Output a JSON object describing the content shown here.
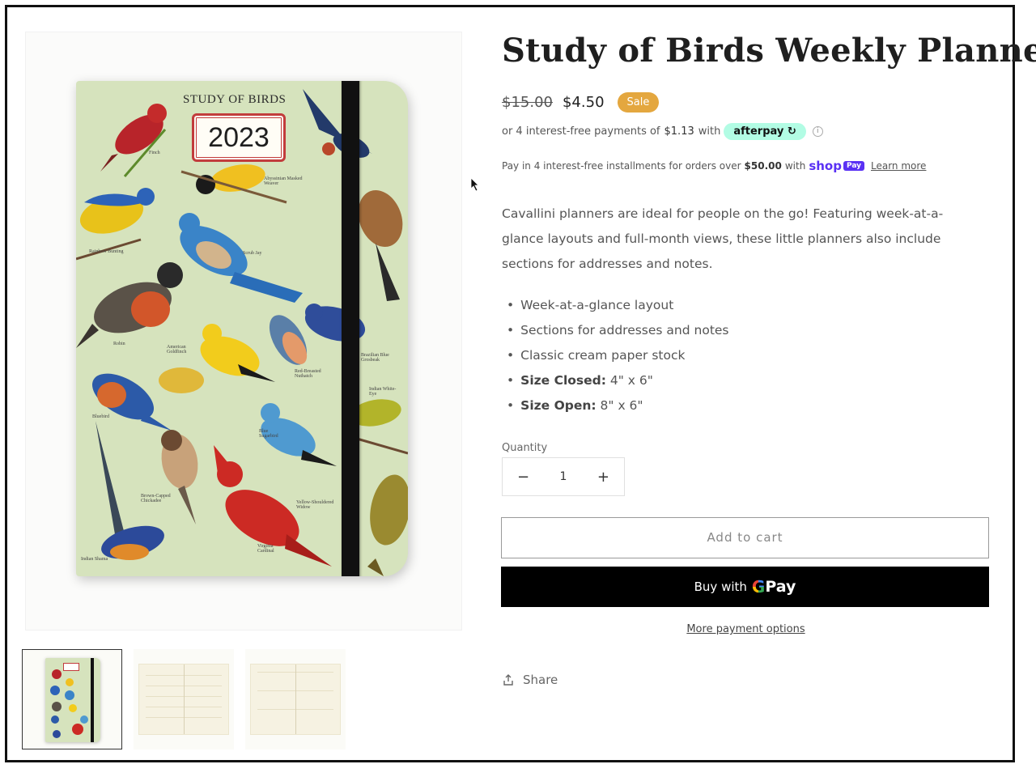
{
  "product": {
    "title": "Study of Birds Weekly Planner",
    "price_original": "$15.00",
    "price_sale": "$4.50",
    "sale_badge": "Sale"
  },
  "afterpay": {
    "prefix": "or 4 interest-free payments of",
    "amount": "$1.13",
    "with": "with",
    "brand": "afterpay",
    "info_icon": "ⓘ"
  },
  "shop_pay": {
    "prefix": "Pay in 4 interest-free installments for orders over",
    "amount": "$50.00",
    "with": "with",
    "brand": "shop",
    "brand_pill": "Pay",
    "learn_more": "Learn more"
  },
  "description": "Cavallini planners are ideal for people on the go! Featuring week-at-a-glance layouts and full-month views, these little planners also include sections for addresses and notes.",
  "features": [
    {
      "label": "",
      "text": "Week-at-a-glance layout"
    },
    {
      "label": "",
      "text": "Sections for addresses and notes"
    },
    {
      "label": "",
      "text": "Classic cream paper stock"
    },
    {
      "label": "Size Closed:",
      "text": " 4\" x 6\""
    },
    {
      "label": "Size Open:",
      "text": " 8\" x 6\""
    }
  ],
  "quantity": {
    "label": "Quantity",
    "value": "1",
    "minus": "−",
    "plus": "+"
  },
  "buttons": {
    "add_to_cart": "Add to cart",
    "buy_with": "Buy with",
    "gpay_g": "G",
    "gpay_pay": "Pay",
    "more_options": "More payment options",
    "share": "Share"
  },
  "cover": {
    "title": "STUDY OF BIRDS",
    "year": "2023",
    "labels": [
      "Finch",
      "Abyssinian Masked Weaver",
      "Rainbow Bunting",
      "Scrub Jay",
      "Robin",
      "American Goldfinch",
      "Red-Breasted Nuthatch",
      "Brazilian Blue Grosbeak",
      "Bluebird",
      "Blue Sugarbird",
      "Indian White-Eye",
      "Brown-Capped Chickadee",
      "Yellow-Shouldered Widow",
      "Virginia Cardinal",
      "Indian Shama"
    ]
  },
  "colors": {
    "sale_badge": "#e4a73f",
    "afterpay": "#b2fce4",
    "shop_pay": "#5a31f4",
    "cover": "#d6e3bd",
    "cover_frame": "#c23c3c"
  }
}
